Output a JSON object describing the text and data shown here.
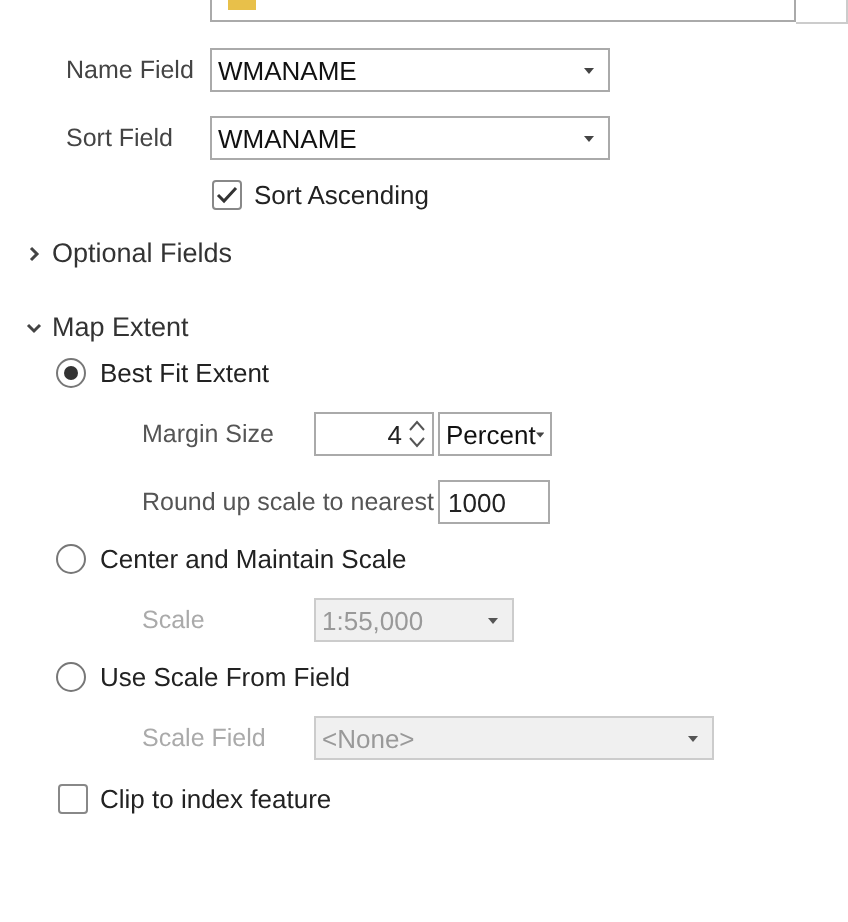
{
  "name_field": {
    "label": "Name Field",
    "value": "WMANAME"
  },
  "sort_field": {
    "label": "Sort Field",
    "value": "WMANAME"
  },
  "sort_ascending": {
    "label": "Sort Ascending",
    "checked": true
  },
  "sections": [
    {
      "label": "Optional Fields",
      "expanded": false
    },
    {
      "label": "Map Extent",
      "expanded": true
    }
  ],
  "extent_options": [
    {
      "label": "Best Fit Extent",
      "selected": true
    },
    {
      "label": "Center and Maintain Scale",
      "selected": false
    },
    {
      "label": "Use Scale From Field",
      "selected": false
    }
  ],
  "margin_size": {
    "label": "Margin Size",
    "value": "4",
    "unit": "Percent"
  },
  "round_up": {
    "label": "Round up scale to nearest",
    "value": "1000"
  },
  "scale": {
    "label": "Scale",
    "value": "1:55,000",
    "disabled": true
  },
  "scale_field": {
    "label": "Scale Field",
    "value": "<None>",
    "disabled": true
  },
  "clip": {
    "label": "Clip to index feature",
    "checked": false
  }
}
